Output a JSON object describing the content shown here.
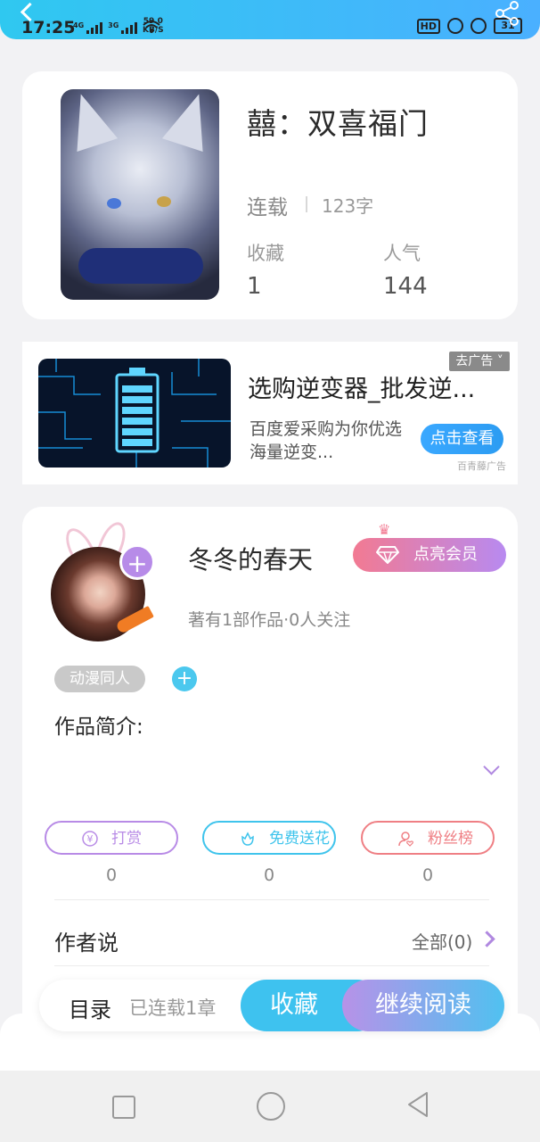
{
  "status_bar": {
    "time": "17:25",
    "net1": "4G",
    "net2": "3G",
    "speed_value": "59.0",
    "speed_unit": "KB/S",
    "hd": "HD",
    "battery": "31"
  },
  "book": {
    "title": "囍：双喜福门",
    "status": "连载",
    "word_count": "123字",
    "favorites_label": "收藏",
    "favorites_value": "1",
    "popularity_label": "人气",
    "popularity_value": "144"
  },
  "ad": {
    "title": "选购逆变器_批发逆...",
    "desc": "百度爱采购为你优选海量逆变...",
    "button": "点击查看",
    "tag": "去广告",
    "source": "百青藤广告"
  },
  "author": {
    "name": "冬冬的春天",
    "vip_button": "点亮会员",
    "meta": "著有1部作品·0人关注",
    "tag": "动漫同人",
    "intro_label": "作品简介:"
  },
  "actions": [
    {
      "label": "打赏",
      "count": "0",
      "icon": "yuan-icon",
      "color": "#b88be6"
    },
    {
      "label": "免费送花",
      "count": "0",
      "icon": "flower-icon",
      "color": "#3fc4ec"
    },
    {
      "label": "粉丝榜",
      "count": "0",
      "icon": "fans-icon",
      "color": "#ef7f84"
    }
  ],
  "author_says": {
    "label": "作者说",
    "all": "全部(0)"
  },
  "bottom_bar": {
    "toc": "目录",
    "serial": "已连载1章",
    "favorite": "收藏",
    "continue": "继续阅读"
  },
  "colors": {
    "accent_blue": "#3ec2ef",
    "accent_purple": "#b792e8"
  }
}
